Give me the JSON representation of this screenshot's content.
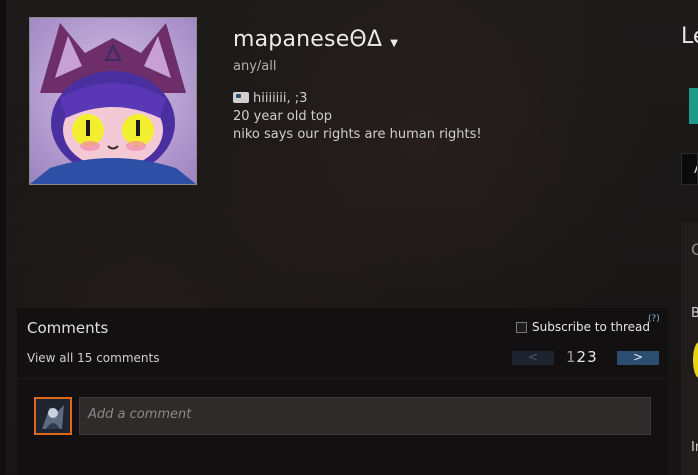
{
  "profile": {
    "name": "mapaneseΘΔ",
    "tagline": "any/all",
    "bio_line1": "hiiiiiii, ;3",
    "bio_line2": "20 year old top",
    "bio_line3": "niko says our rights are human rights!"
  },
  "right_column": {
    "level_partial": "Le",
    "dropdown_partial": "A",
    "panel_letter_1": "C",
    "panel_letter_2": "B",
    "panel_letter_3": "In"
  },
  "comments": {
    "title": "Comments",
    "view_all": "View all 15 comments",
    "subscribe_label": "Subscribe to thread",
    "help": "(?)",
    "prev_label": "<",
    "next_label": ">",
    "page_1": "1",
    "page_2": "2",
    "page_3": "3",
    "input_placeholder": "Add a comment"
  },
  "colors": {
    "accent_teal": "#1f9a8a",
    "next_button": "#2a4d70",
    "avatar_border": "#e0661c"
  }
}
